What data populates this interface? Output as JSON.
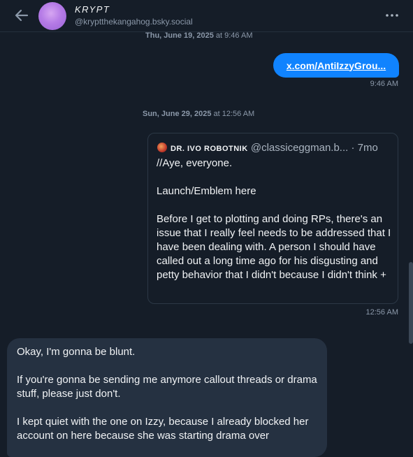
{
  "header": {
    "display_name": "KRYPT",
    "handle": "@kryptthekangahog.bsky.social",
    "back_icon": "arrow-left-icon",
    "more_icon": "ellipsis-horizontal-icon"
  },
  "messages": {
    "sep1_day": "Thu, June 19, 2025",
    "sep1_rest": "at 9:46 AM",
    "link_text": "x.com/AntiIzzyGrou...",
    "link_time": "9:46 AM",
    "sep2_day": "Sun, June 29, 2025",
    "sep2_rest": "at 12:56 AM",
    "quote": {
      "name": "DR. IVO ROBOTNIK",
      "handle": "@classiceggman.b...",
      "age": "· 7mo",
      "text": "//Aye, everyone.\n\nLaunch/Emblem here\n\nBefore I get to plotting and doing RPs, there's an issue that I really feel needs to be addressed that I have been dealing with. A person I should have called out a long time ago for his disgusting and petty behavior that I didn't because I didn't think +"
    },
    "quote_time": "12:56 AM",
    "incoming_text": "Okay, I'm gonna be blunt.\n\nIf you're gonna be sending me anymore callout threads or drama stuff, please just don't.\n\nI kept quiet with the one on Izzy, because I already blocked her account on here because she was starting drama over"
  },
  "colors": {
    "background": "#151d28",
    "accent": "#1083fe",
    "incoming_bubble": "#253141"
  }
}
